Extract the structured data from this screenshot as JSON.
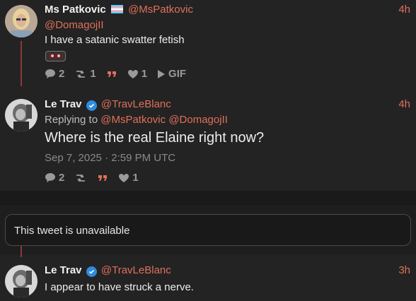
{
  "tweets": [
    {
      "name": "Ms Patkovic",
      "handle": "@MsPatkovic",
      "time": "4h",
      "reply_mention": "@DomagojII",
      "text": "I have a satanic swatter fetish",
      "stats": {
        "replies": "2",
        "retweets": "1",
        "likes": "1",
        "gif_label": "GIF"
      }
    },
    {
      "name": "Le Trav",
      "handle": "@TravLeBlanc",
      "time": "4h",
      "replying_prefix": "Replying to",
      "replying_to_1": "@MsPatkovic",
      "replying_to_2": "@DomagojII",
      "text": "Where is the real Elaine right now?",
      "date": "Sep 7, 2025 · 2:59 PM UTC",
      "stats": {
        "replies": "2",
        "likes": "1"
      }
    },
    {
      "name": "Le Trav",
      "handle": "@TravLeBlanc",
      "time": "3h",
      "text": "I appear to have struck a nerve."
    }
  ],
  "unavailable_text": "This tweet is unavailable",
  "colors": {
    "accent": "#e0705a",
    "verified": "#2f8be0",
    "thread_line": "#8a3a3a"
  },
  "icons": [
    "comment-icon",
    "retweet-icon",
    "quote-icon",
    "heart-icon",
    "play-icon",
    "verified-badge-icon",
    "trans-flag-icon"
  ]
}
